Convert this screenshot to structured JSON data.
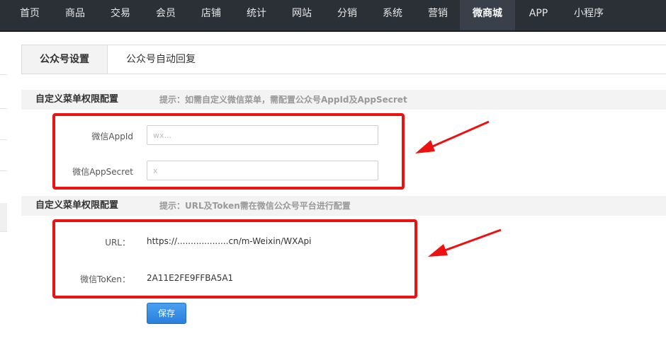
{
  "nav": {
    "items": [
      {
        "label": "首页"
      },
      {
        "label": "商品"
      },
      {
        "label": "交易"
      },
      {
        "label": "会员"
      },
      {
        "label": "店铺"
      },
      {
        "label": "统计"
      },
      {
        "label": "网站"
      },
      {
        "label": "分销"
      },
      {
        "label": "系统"
      },
      {
        "label": "营销"
      },
      {
        "label": "微商城"
      },
      {
        "label": "APP"
      },
      {
        "label": "小程序"
      }
    ],
    "active_label": "微商城"
  },
  "tabs": {
    "active": "公众号设置",
    "second": "公众号自动回复"
  },
  "section1": {
    "title": "自定义菜单权限配置",
    "tip": "提示：如需自定义微信菜单，需配置公众号AppId及AppSecret",
    "appid_label": "微信AppId",
    "appid_value": "wx...",
    "appsecret_label": "微信AppSecret",
    "appsecret_value": "x"
  },
  "section2": {
    "title": "自定义菜单权限配置",
    "tip": "提示：URL及Token需在微信公众号平台进行配置",
    "url_label": "URL：",
    "url_value": "https://...................cn/m-Weixin/WXApi",
    "token_label": "微信ToKen：",
    "token_value": "2A11E2FE9FFBA5A1"
  },
  "save_label": "保存",
  "colors": {
    "nav_bg": "#2b2f36",
    "accent": "#2e86e6",
    "highlight": "#ee1111"
  }
}
